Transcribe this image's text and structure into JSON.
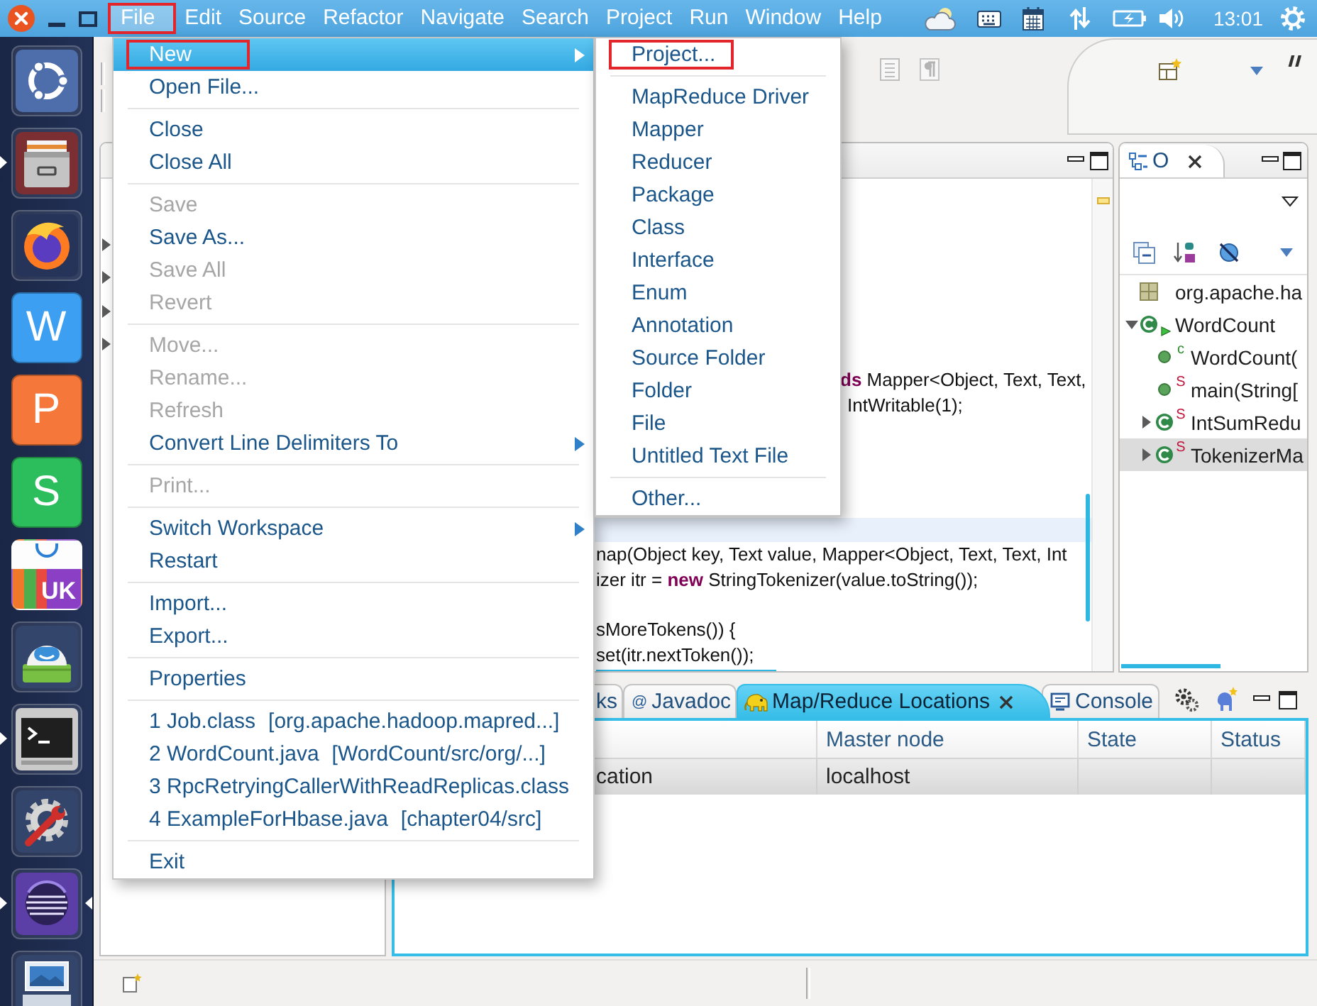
{
  "top_panel": {
    "menus": [
      {
        "label": "File",
        "selected": true,
        "annotated": true
      },
      {
        "label": "Edit",
        "selected": false,
        "annotated": false
      },
      {
        "label": "Source",
        "selected": false,
        "annotated": false
      },
      {
        "label": "Refactor",
        "selected": false,
        "annotated": false
      },
      {
        "label": "Navigate",
        "selected": false,
        "annotated": false
      },
      {
        "label": "Search",
        "selected": false,
        "annotated": false
      },
      {
        "label": "Project",
        "selected": false,
        "annotated": false
      },
      {
        "label": "Run",
        "selected": false,
        "annotated": false
      },
      {
        "label": "Window",
        "selected": false,
        "annotated": false
      },
      {
        "label": "Help",
        "selected": false,
        "annotated": false
      }
    ],
    "clock": "13:01"
  },
  "launcher": [
    {
      "kind": "ring",
      "running": false,
      "focused": false
    },
    {
      "kind": "cabinet",
      "running": true,
      "focused": false
    },
    {
      "kind": "globe",
      "running": false,
      "focused": false
    },
    {
      "kind": "tile",
      "label": "W",
      "color": "#3d9ff2",
      "running": false,
      "focused": false
    },
    {
      "kind": "tile",
      "label": "P",
      "color": "#f5773a",
      "running": false,
      "focused": false
    },
    {
      "kind": "tile",
      "label": "S",
      "color": "#2cbd5c",
      "running": false,
      "focused": false
    },
    {
      "kind": "bag",
      "label": "UK",
      "running": false,
      "focused": false
    },
    {
      "kind": "robot",
      "running": false,
      "focused": false
    },
    {
      "kind": "terminal",
      "running": true,
      "focused": false
    },
    {
      "kind": "tools",
      "running": false,
      "focused": false
    },
    {
      "kind": "sphere",
      "running": true,
      "focused": true
    },
    {
      "kind": "photos",
      "running": false,
      "focused": false
    }
  ],
  "file_menu": {
    "groups": [
      [
        {
          "label": "New",
          "disabled": false,
          "selected": true,
          "submenu": true,
          "annotated": true
        },
        {
          "label": "Open File...",
          "disabled": false,
          "selected": false,
          "submenu": false,
          "annotated": false
        }
      ],
      [
        {
          "label": "Close",
          "disabled": false,
          "selected": false,
          "submenu": false,
          "annotated": false
        },
        {
          "label": "Close All",
          "disabled": false,
          "selected": false,
          "submenu": false,
          "annotated": false
        }
      ],
      [
        {
          "label": "Save",
          "disabled": true,
          "selected": false,
          "submenu": false,
          "annotated": false
        },
        {
          "label": "Save As...",
          "disabled": false,
          "selected": false,
          "submenu": false,
          "annotated": false
        },
        {
          "label": "Save All",
          "disabled": true,
          "selected": false,
          "submenu": false,
          "annotated": false
        },
        {
          "label": "Revert",
          "disabled": true,
          "selected": false,
          "submenu": false,
          "annotated": false
        }
      ],
      [
        {
          "label": "Move...",
          "disabled": true,
          "selected": false,
          "submenu": false,
          "annotated": false
        },
        {
          "label": "Rename...",
          "disabled": true,
          "selected": false,
          "submenu": false,
          "annotated": false
        },
        {
          "label": "Refresh",
          "disabled": true,
          "selected": false,
          "submenu": false,
          "annotated": false
        },
        {
          "label": "Convert Line Delimiters To",
          "disabled": false,
          "selected": false,
          "submenu": true,
          "annotated": false
        }
      ],
      [
        {
          "label": "Print...",
          "disabled": true,
          "selected": false,
          "submenu": false,
          "annotated": false
        }
      ],
      [
        {
          "label": "Switch Workspace",
          "disabled": false,
          "selected": false,
          "submenu": true,
          "annotated": false
        },
        {
          "label": "Restart",
          "disabled": false,
          "selected": false,
          "submenu": false,
          "annotated": false
        }
      ],
      [
        {
          "label": "Import...",
          "disabled": false,
          "selected": false,
          "submenu": false,
          "annotated": false
        },
        {
          "label": "Export...",
          "disabled": false,
          "selected": false,
          "submenu": false,
          "annotated": false
        }
      ],
      [
        {
          "label": "Properties",
          "disabled": false,
          "selected": false,
          "submenu": false,
          "annotated": false
        }
      ],
      [
        {
          "label": "1 Job.class",
          "detail": "[org.apache.hadoop.mapred...]",
          "disabled": false,
          "selected": false,
          "submenu": false,
          "annotated": false
        },
        {
          "label": "2 WordCount.java",
          "detail": "[WordCount/src/org/...]",
          "disabled": false,
          "selected": false,
          "submenu": false,
          "annotated": false
        },
        {
          "label": "3 RpcRetryingCallerWithReadReplicas.class",
          "disabled": false,
          "selected": false,
          "submenu": false,
          "annotated": false
        },
        {
          "label": "4 ExampleForHbase.java",
          "detail": "[chapter04/src]",
          "disabled": false,
          "selected": false,
          "submenu": false,
          "annotated": false
        }
      ],
      [
        {
          "label": "Exit",
          "disabled": false,
          "selected": false,
          "submenu": false,
          "annotated": false
        }
      ]
    ]
  },
  "new_submenu": {
    "groups": [
      [
        {
          "label": "Project...",
          "disabled": false,
          "selected": false,
          "submenu": false,
          "annotated": true
        }
      ],
      [
        {
          "label": "MapReduce Driver",
          "disabled": false,
          "selected": false,
          "submenu": false,
          "annotated": false
        },
        {
          "label": "Mapper",
          "disabled": false,
          "selected": false,
          "submenu": false,
          "annotated": false
        },
        {
          "label": "Reducer",
          "disabled": false,
          "selected": false,
          "submenu": false,
          "annotated": false
        },
        {
          "label": "Package",
          "disabled": false,
          "selected": false,
          "submenu": false,
          "annotated": false
        },
        {
          "label": "Class",
          "disabled": false,
          "selected": false,
          "submenu": false,
          "annotated": false
        },
        {
          "label": "Interface",
          "disabled": false,
          "selected": false,
          "submenu": false,
          "annotated": false
        },
        {
          "label": "Enum",
          "disabled": false,
          "selected": false,
          "submenu": false,
          "annotated": false
        },
        {
          "label": "Annotation",
          "disabled": false,
          "selected": false,
          "submenu": false,
          "annotated": false
        },
        {
          "label": "Source Folder",
          "disabled": false,
          "selected": false,
          "submenu": false,
          "annotated": false
        },
        {
          "label": "Folder",
          "disabled": false,
          "selected": false,
          "submenu": false,
          "annotated": false
        },
        {
          "label": "File",
          "disabled": false,
          "selected": false,
          "submenu": false,
          "annotated": false
        },
        {
          "label": "Untitled Text File",
          "disabled": false,
          "selected": false,
          "submenu": false,
          "annotated": false
        }
      ],
      [
        {
          "label": "Other...",
          "disabled": false,
          "selected": false,
          "submenu": false,
          "annotated": false
        }
      ]
    ]
  },
  "package_explorer": {
    "items": [
      {
        "expanded": false
      },
      {
        "expanded": false
      },
      {
        "expanded": false
      },
      {
        "expanded": false
      }
    ]
  },
  "editor": {
    "code_lines": [
      {
        "current": false,
        "tokens": [
          {
            "kind": "keyword",
            "text": "ds"
          },
          {
            "kind": "plain",
            "text": " Mapper<Object, Text, Text,"
          }
        ]
      },
      {
        "current": false,
        "tokens": [
          {
            "kind": "plain",
            "text": "IntWritable(1);"
          }
        ]
      },
      {
        "current": true
      },
      {
        "current": false,
        "tokens": [
          {
            "kind": "plain",
            "text": "nap(Object key, Text value, Mapper<Object, Text, Text, Int"
          }
        ]
      },
      {
        "current": false,
        "tokens": [
          {
            "kind": "plain",
            "text": "izer itr = "
          },
          {
            "kind": "keyword",
            "text": "new"
          },
          {
            "kind": "plain",
            "text": " StringTokenizer(value.toString());"
          }
        ]
      },
      {
        "current": false,
        "tokens": [
          {
            "kind": "plain",
            "text": "sMoreTokens()) {"
          }
        ]
      },
      {
        "current": false,
        "tokens": [
          {
            "kind": "plain",
            "text": "set(itr.nextToken());"
          }
        ]
      }
    ]
  },
  "outline": {
    "title": "O",
    "tree": [
      {
        "kind": "package",
        "label": "org.apache.ha",
        "selected": false
      },
      {
        "kind": "class",
        "label": "WordCount",
        "expanded": true,
        "runnable": true,
        "selected": false,
        "children": [
          {
            "kind": "constructor",
            "label": "WordCount(",
            "badge": "c",
            "selected": false
          },
          {
            "kind": "method",
            "label": "main(String[",
            "badge": "S",
            "selected": false
          },
          {
            "kind": "class",
            "label": "IntSumRedu",
            "badge": "S",
            "expanded": false,
            "runnable": false,
            "selected": false
          },
          {
            "kind": "class",
            "label": "TokenizerMa",
            "badge": "S",
            "expanded": false,
            "runnable": false,
            "selected": true
          }
        ]
      }
    ]
  },
  "bottom_panel": {
    "tabs": [
      {
        "kind": "plain",
        "label": "ks",
        "selected": false
      },
      {
        "kind": "javadoc",
        "glyph": "@",
        "label": "Javadoc",
        "selected": false
      },
      {
        "kind": "mapreduce",
        "label": "Map/Reduce Locations",
        "selected": true
      },
      {
        "kind": "console",
        "label": "Console",
        "selected": false
      }
    ],
    "table": {
      "columns": [
        "Master node",
        "State",
        "Status"
      ],
      "rows": [
        {
          "selected": true,
          "column_1": "cation",
          "master_node": "localhost"
        }
      ]
    }
  }
}
